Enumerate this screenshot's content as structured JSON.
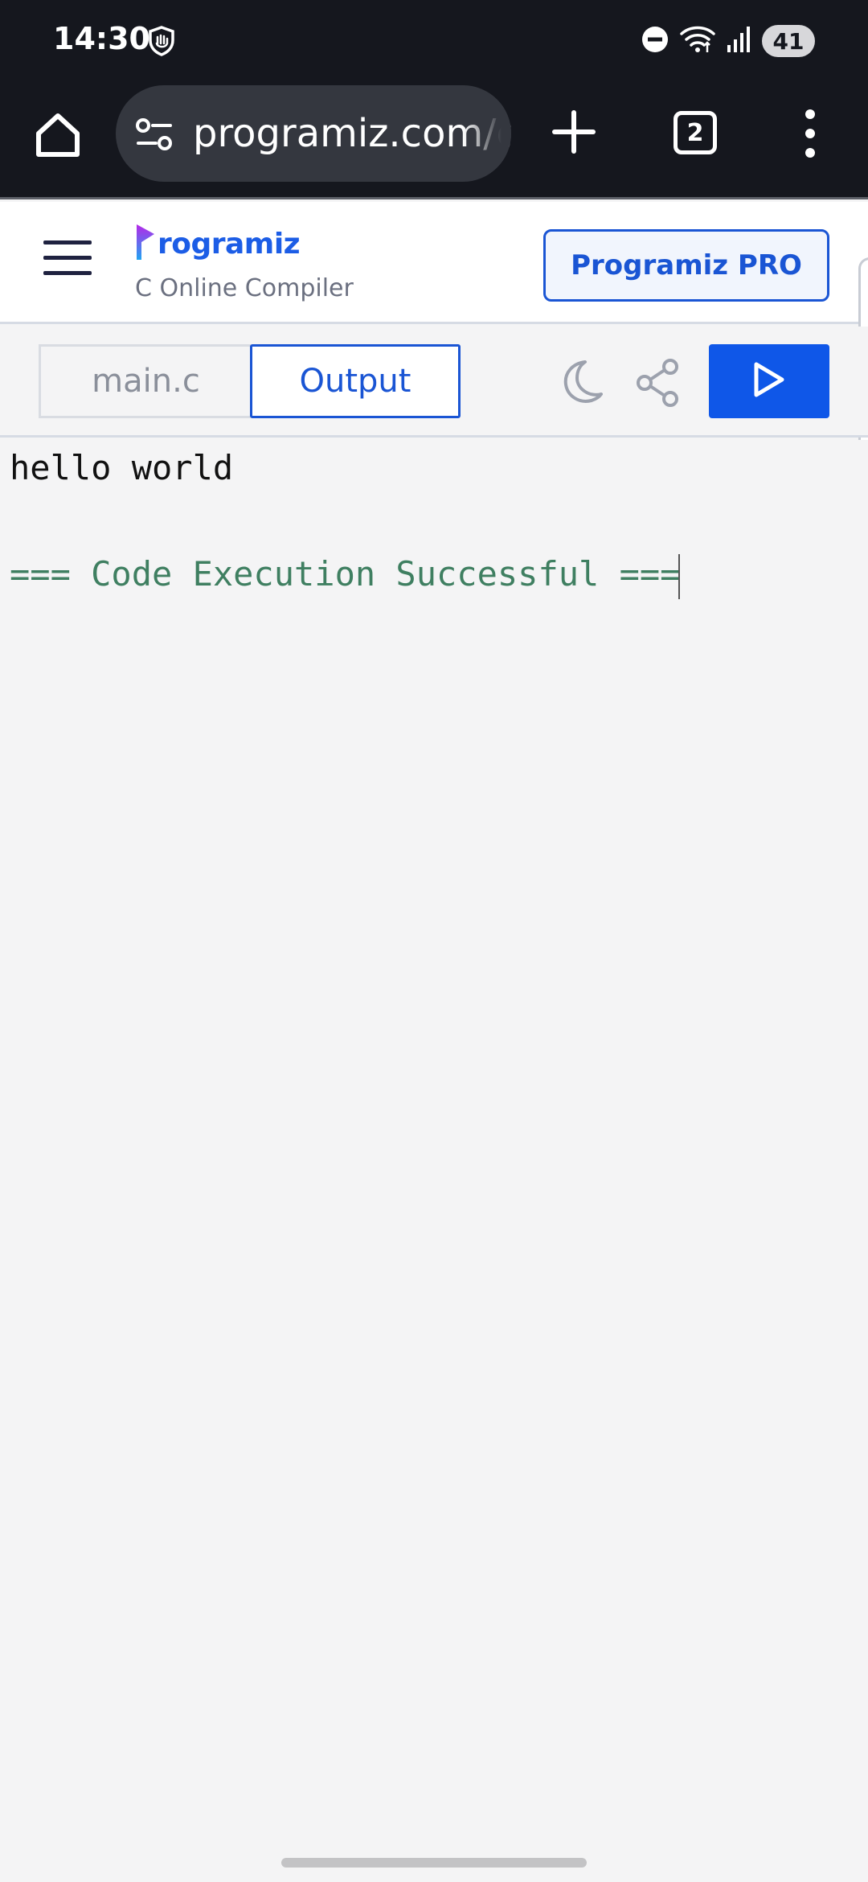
{
  "status_bar": {
    "time": "14:30",
    "battery": "41",
    "icons": [
      "shield-hand-icon",
      "do-not-disturb-icon",
      "wifi-icon",
      "signal-icon"
    ]
  },
  "browser": {
    "url": "programiz.com/c-",
    "tab_count": "2",
    "icons": [
      "home-icon",
      "site-settings-icon",
      "plus-icon",
      "more-vert-icon"
    ]
  },
  "header": {
    "logo_text": "rogramiz",
    "subtitle": "C Online Compiler",
    "pro_button_label": "Programiz PRO"
  },
  "toolbar": {
    "tab_main_label": "main.c",
    "tab_output_label": "Output",
    "icons": [
      "moon-icon",
      "share-icon",
      "play-icon"
    ]
  },
  "output": {
    "line1": "hello world",
    "line2": "=== Code Execution Successful ==="
  },
  "colors": {
    "brand_blue": "#1a55d4",
    "run_blue": "#0f57e8",
    "success_green": "#3f7f61",
    "chrome_dark": "#15171e"
  }
}
